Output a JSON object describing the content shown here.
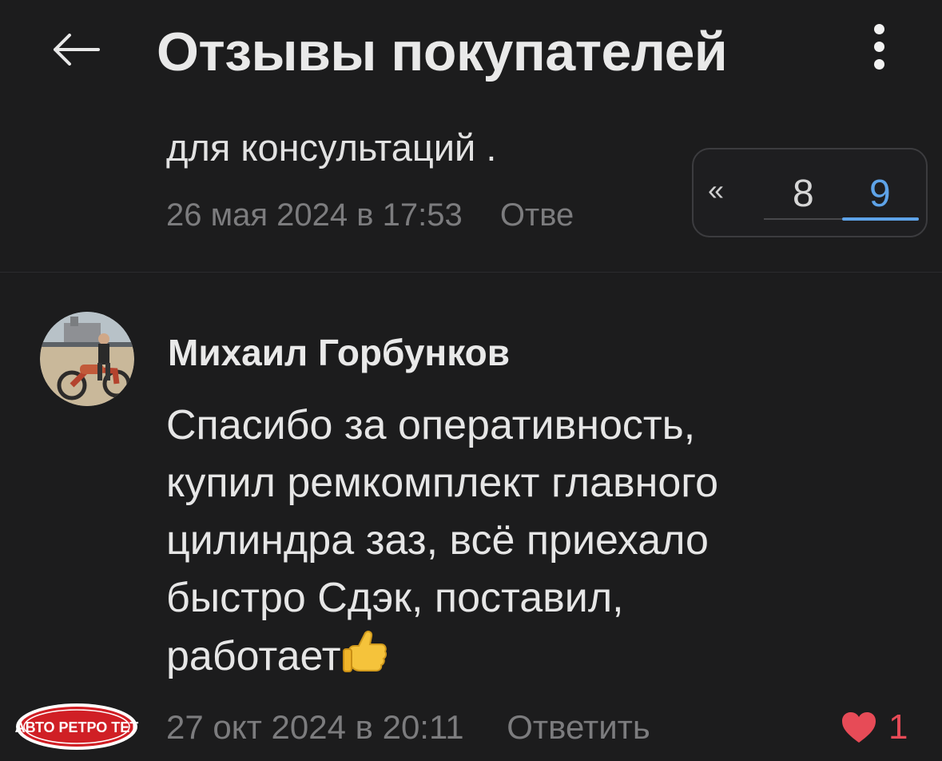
{
  "header": {
    "title": "Отзывы покупателей",
    "back_icon": "arrow-left-icon",
    "menu_icon": "more-vertical-icon"
  },
  "previous_comment": {
    "text_tail": "для консультаций .",
    "timestamp": "26 мая 2024 в 17:53",
    "reply_label": "Отве"
  },
  "pager": {
    "first": "«",
    "pages": [
      "8",
      "9"
    ],
    "current_page": "9",
    "accent_color": "#5ea3e8"
  },
  "comment": {
    "author": "Михаил Горбунков",
    "text_lines": [
      "Спасибо за оперативность,",
      "купил ремкомплект главного",
      "цилиндра заз, всё приехало",
      "быстро Сдэк, поставил,",
      "работает"
    ],
    "emoji": "thumbs-up",
    "timestamp": "27 окт 2024 в 20:11",
    "reply_label": "Ответить",
    "likes": "1",
    "like_color": "#e74b57"
  },
  "vendor_reply": {
    "logo_text": "АВТО РЕТРО ТЕТ"
  }
}
